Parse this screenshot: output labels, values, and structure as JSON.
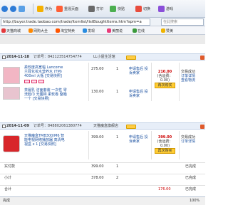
{
  "toolbar": {
    "nav": "←",
    "buttons": [
      {
        "label": "作为"
      },
      {
        "label": "重混页面"
      },
      {
        "label": "打印"
      },
      {
        "label": "快贴"
      },
      {
        "label": "切换"
      },
      {
        "label": "游戏"
      }
    ]
  },
  "address": {
    "url": "http://buyer.trade.taobao.com/trade/itemlist/listBoughtItems.htm?spm=a",
    "search_placeholder": "在此搜索"
  },
  "favorites": [
    {
      "label": "天猫商城"
    },
    {
      "label": "网购大全"
    },
    {
      "label": "淘宝特卖"
    },
    {
      "label": "发现"
    },
    {
      "label": "美丽说"
    },
    {
      "label": "在线"
    },
    {
      "label": "赞美"
    }
  ],
  "orders": [
    {
      "date": "2014-11-18",
      "order_no": "订单号：842123514754774",
      "shop": "LL小屋生活馆",
      "items": [
        {
          "title": "柔软度高宽幅 Lancome 兰蔻化妆水营养水 (TM) 400ml 大瓶 [交易快照]",
          "price": "275.00",
          "qty": "1",
          "service": "申请售后 投诉卖家",
          "thumb_color": "#f2b6c4"
        },
        {
          "title": "茶履乳 洁面套装 一次性 零 洗脸巾 无菌棉 柔软卷 整箱 一个 [交易快照]",
          "price": "130.00",
          "qty": "1",
          "service": "申请售后 投诉卖家",
          "thumb_color": "#e8c4cf"
        }
      ],
      "total": "210.00",
      "total_note": "(含运费：0.00)",
      "status_lines": [
        "交易成功",
        "订单详情",
        "查看物流"
      ],
      "action": "再次购买"
    },
    {
      "date": "2014-11-09",
      "order_no": "订单号：848802061380774",
      "shop": "天猫魔盒旗舰店",
      "items": [
        {
          "title": "天猫魔盒TMB300/M6 智能电视网络播放器 高清电视盒 x 1 [交易快照]",
          "price": "399.00",
          "qty": "1",
          "service": "申请售后 投诉卖家",
          "thumb_color": "#d8262a"
        }
      ],
      "total": "399.00",
      "total_note": "(含运费：0.00)",
      "status_lines": [
        "交易成功",
        "订单详情"
      ],
      "action": "再次购买"
    }
  ],
  "summary_rows": [
    {
      "label": "实付款",
      "value": "399.00",
      "qty": "1",
      "status": "已完成"
    },
    {
      "label": "小计",
      "value": "378.00",
      "qty": "2",
      "status": "已完成"
    },
    {
      "label": "合计",
      "value": "176.00",
      "qty": "",
      "status": "已完成"
    }
  ],
  "statusbar": {
    "left": "完成",
    "right": "100%"
  },
  "colors": {
    "accent": "#1a50a0",
    "price_red": "#c00000",
    "header_blue": "#e7eef8"
  }
}
